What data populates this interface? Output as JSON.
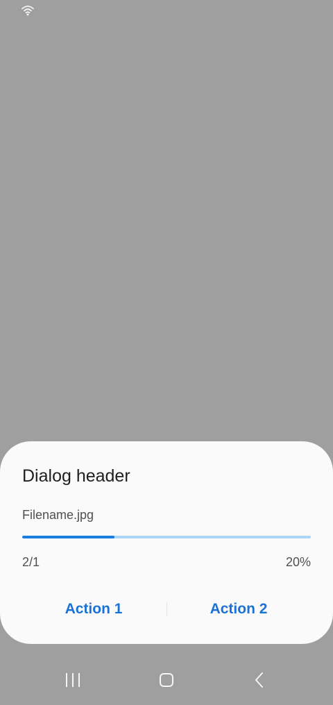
{
  "status_bar": {
    "icons": [
      "wifi-icon"
    ]
  },
  "dialog": {
    "title": "Dialog header",
    "filename": "Filename.jpg",
    "progress": 0.32,
    "count": "2/1",
    "percent": "20%",
    "actions": [
      {
        "label": "Action 1"
      },
      {
        "label": "Action 2"
      }
    ]
  },
  "navigation_bar": {
    "buttons": [
      "recents-icon",
      "home-icon",
      "back-icon"
    ]
  },
  "colors": {
    "scrim": "#9f9f9f",
    "dialog_background": "#fafafa",
    "accent": "#1a7ee0",
    "progress_track": "#acd6f7",
    "action_text": "#1a72d6"
  }
}
